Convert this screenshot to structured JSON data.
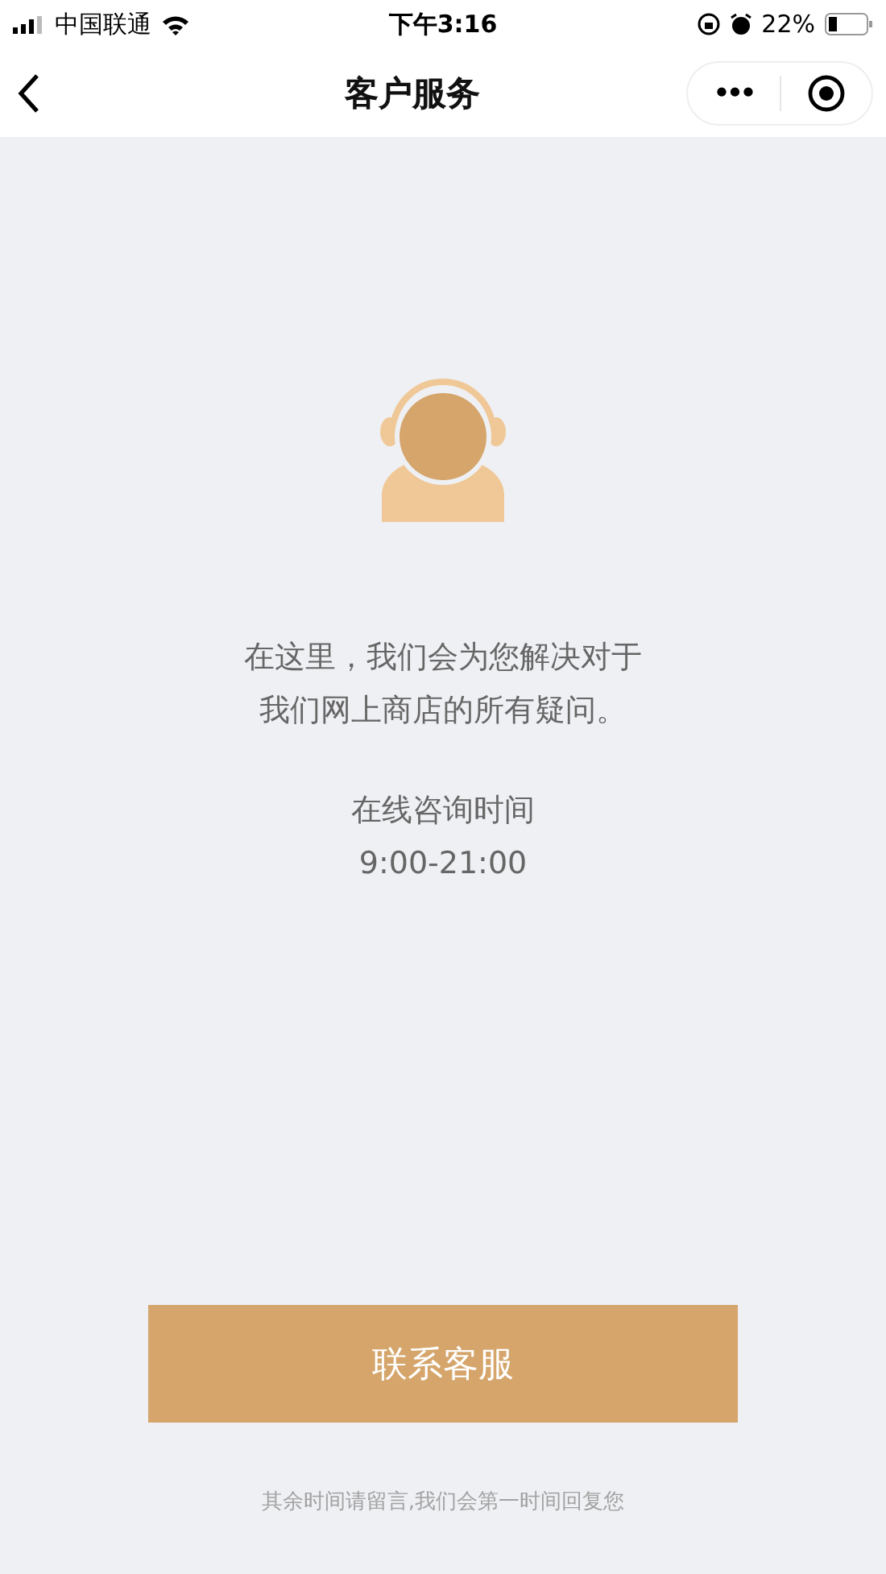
{
  "status_bar": {
    "carrier": "中国联通",
    "time": "下午3:16",
    "battery": "22%"
  },
  "nav": {
    "title": "客户服务",
    "more": "•••"
  },
  "intro_lines": [
    "在这里，我们会为您解决对于",
    "我们网上商店的所有疑问。"
  ],
  "hours": {
    "label": "在线咨询时间",
    "value": "9:00-21:00"
  },
  "contact_button": "联系客服",
  "footer_note": "其余时间请留言,我们会第一时间回复您"
}
